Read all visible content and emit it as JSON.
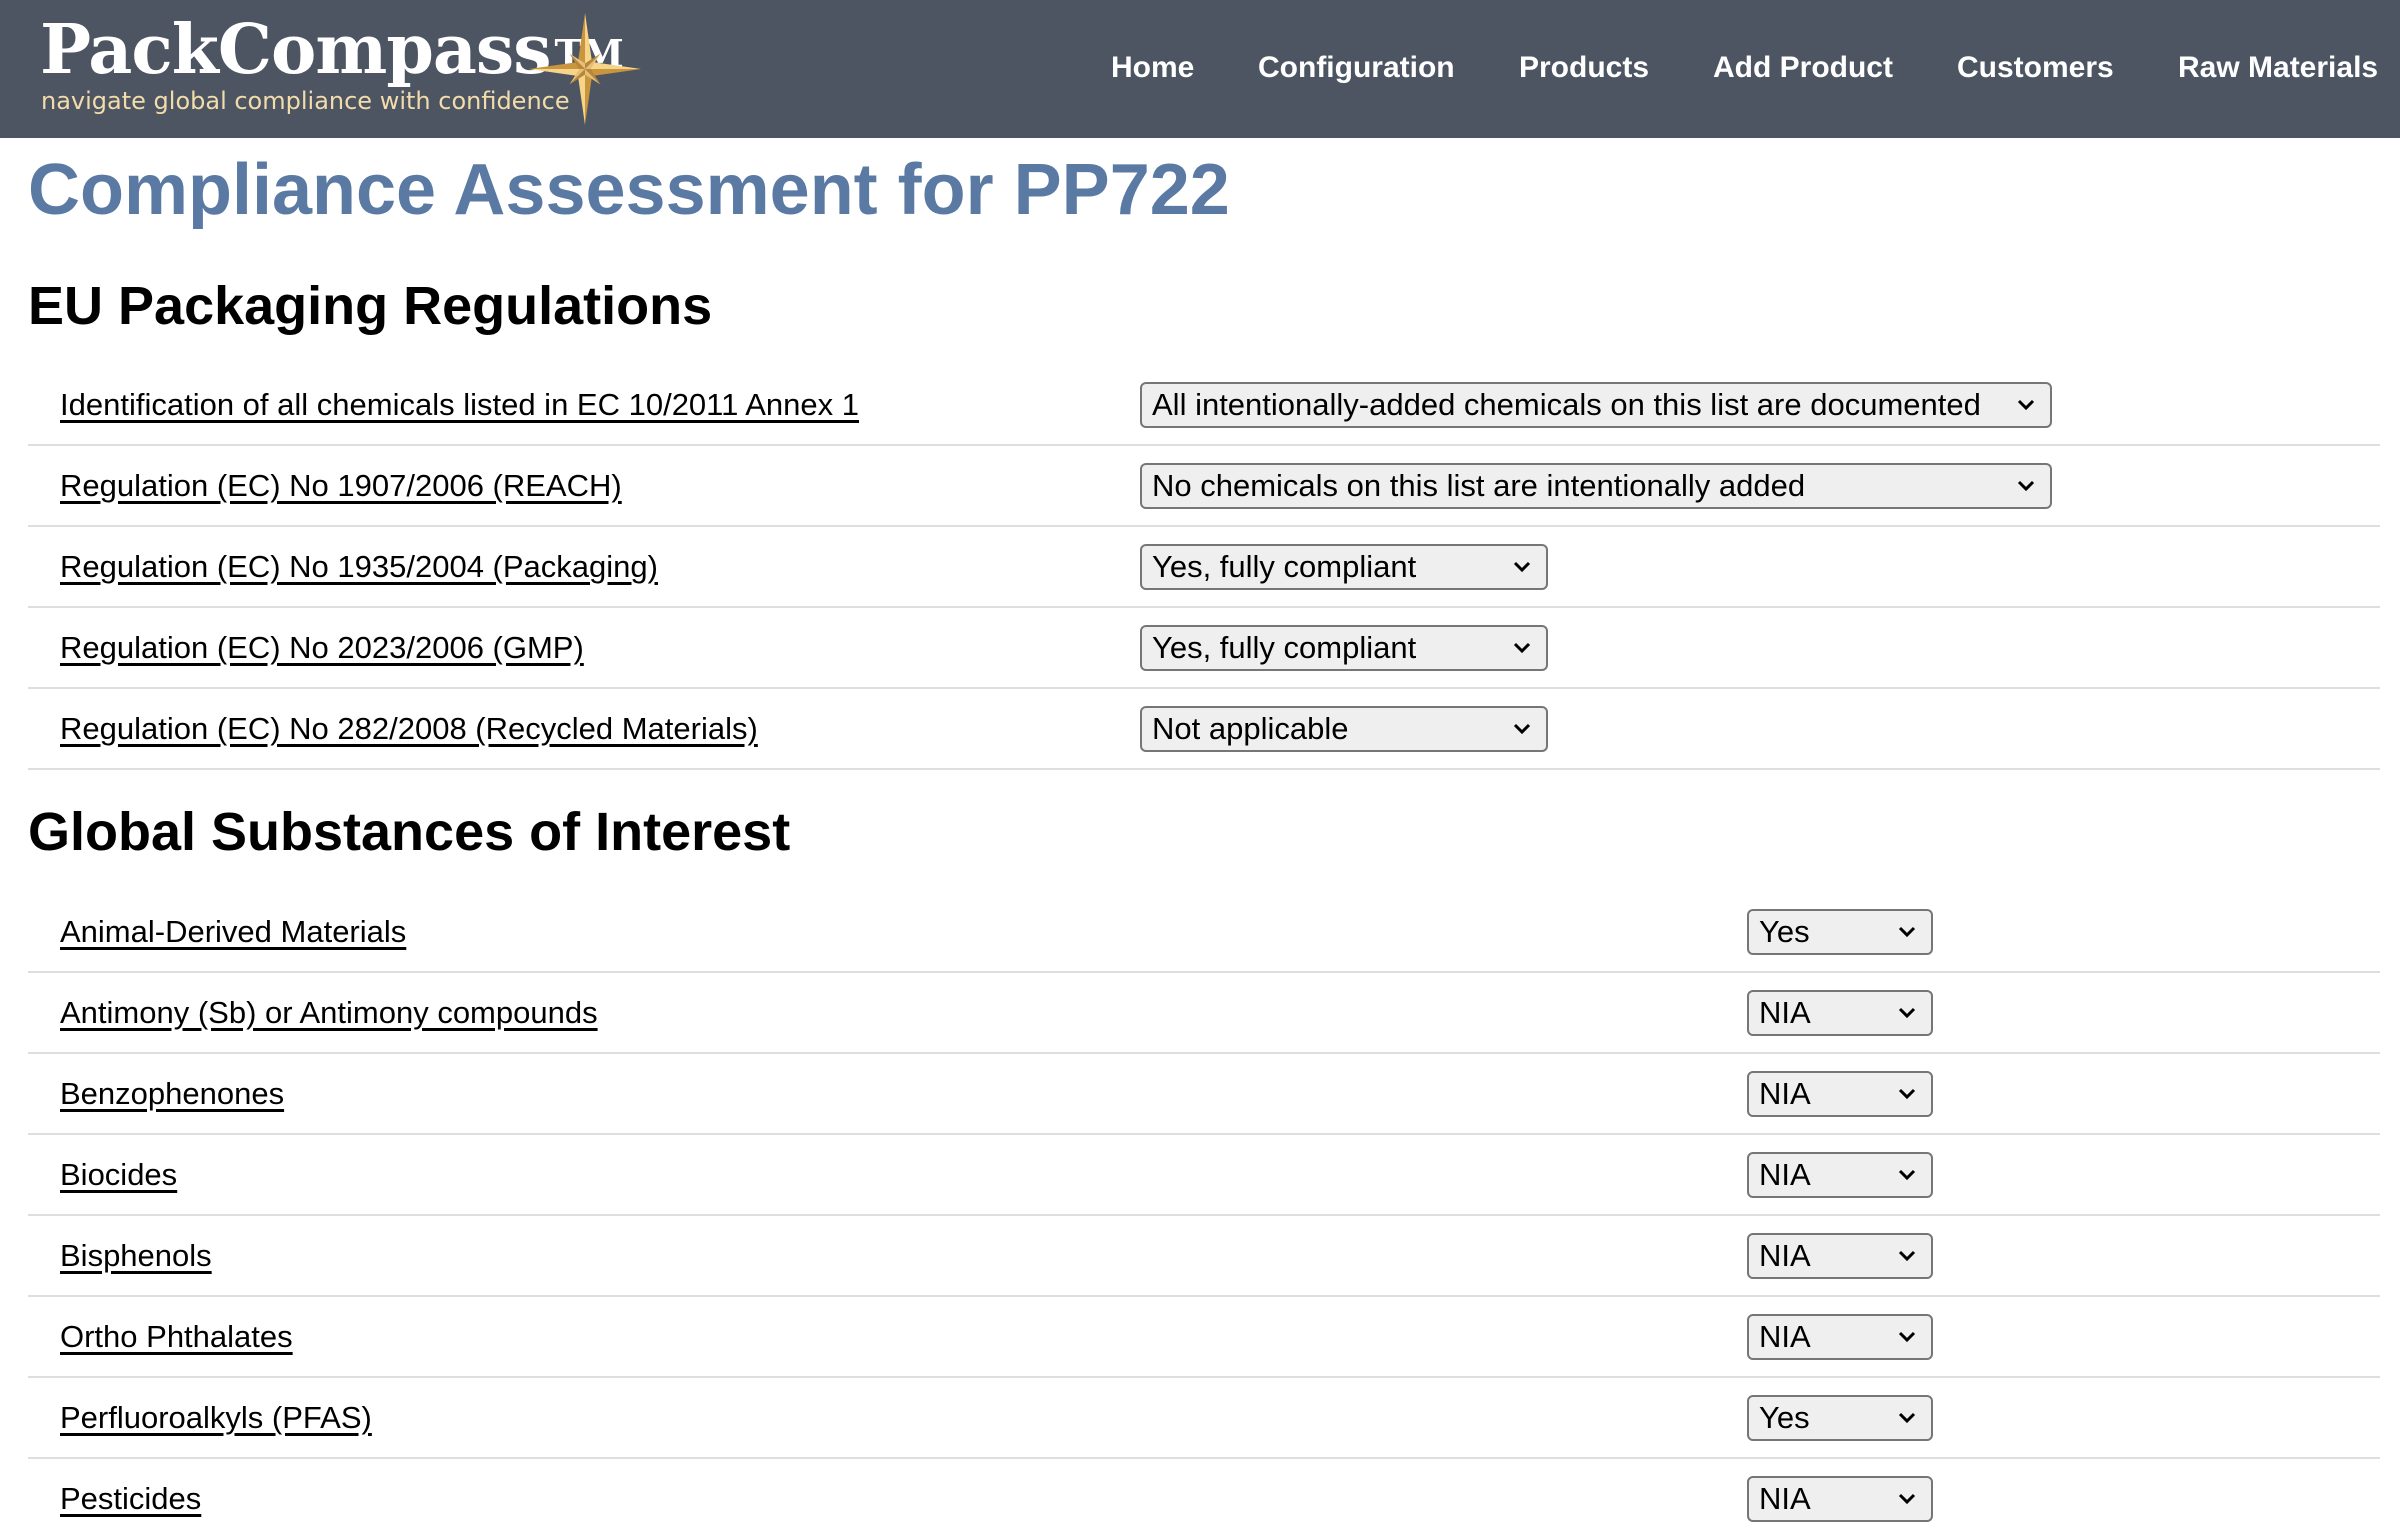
{
  "header": {
    "brand": "PackCompass",
    "trademark": "TM",
    "tagline": "navigate global compliance with confidence",
    "colors": {
      "background": "#4d5563",
      "tagline": "#f2dcaa",
      "compass": "#e8b85a"
    }
  },
  "nav": {
    "items": [
      "Home",
      "Configuration",
      "Products",
      "Add Product",
      "Customers",
      "Raw Materials"
    ]
  },
  "page": {
    "title": "Compliance Assessment for PP722",
    "title_color": "#5b7aa3"
  },
  "eu": {
    "heading": "EU Packaging Regulations",
    "rows": [
      {
        "label": "Identification of all chemicals listed in EC 10/2011 Annex 1",
        "value": "All intentionally-added chemicals on this list are documented"
      },
      {
        "label": "Regulation (EC) No 1907/2006 (REACH)",
        "value": "No chemicals on this list are intentionally added"
      },
      {
        "label": "Regulation (EC) No 1935/2004 (Packaging)",
        "value": "Yes, fully compliant"
      },
      {
        "label": "Regulation (EC) No 2023/2006 (GMP)",
        "value": "Yes, fully compliant"
      },
      {
        "label": "Regulation (EC) No 282/2008 (Recycled Materials)",
        "value": "Not applicable"
      }
    ]
  },
  "gsi": {
    "heading": "Global Substances of Interest",
    "rows": [
      {
        "label": "Animal-Derived Materials",
        "value": "Yes"
      },
      {
        "label": "Antimony (Sb) or Antimony compounds",
        "value": "NIA"
      },
      {
        "label": "Benzophenones",
        "value": "NIA"
      },
      {
        "label": "Biocides",
        "value": "NIA"
      },
      {
        "label": "Bisphenols",
        "value": "NIA"
      },
      {
        "label": "Ortho Phthalates",
        "value": "NIA"
      },
      {
        "label": "Perfluoroalkyls (PFAS)",
        "value": "Yes"
      },
      {
        "label": "Pesticides",
        "value": "NIA"
      }
    ]
  }
}
